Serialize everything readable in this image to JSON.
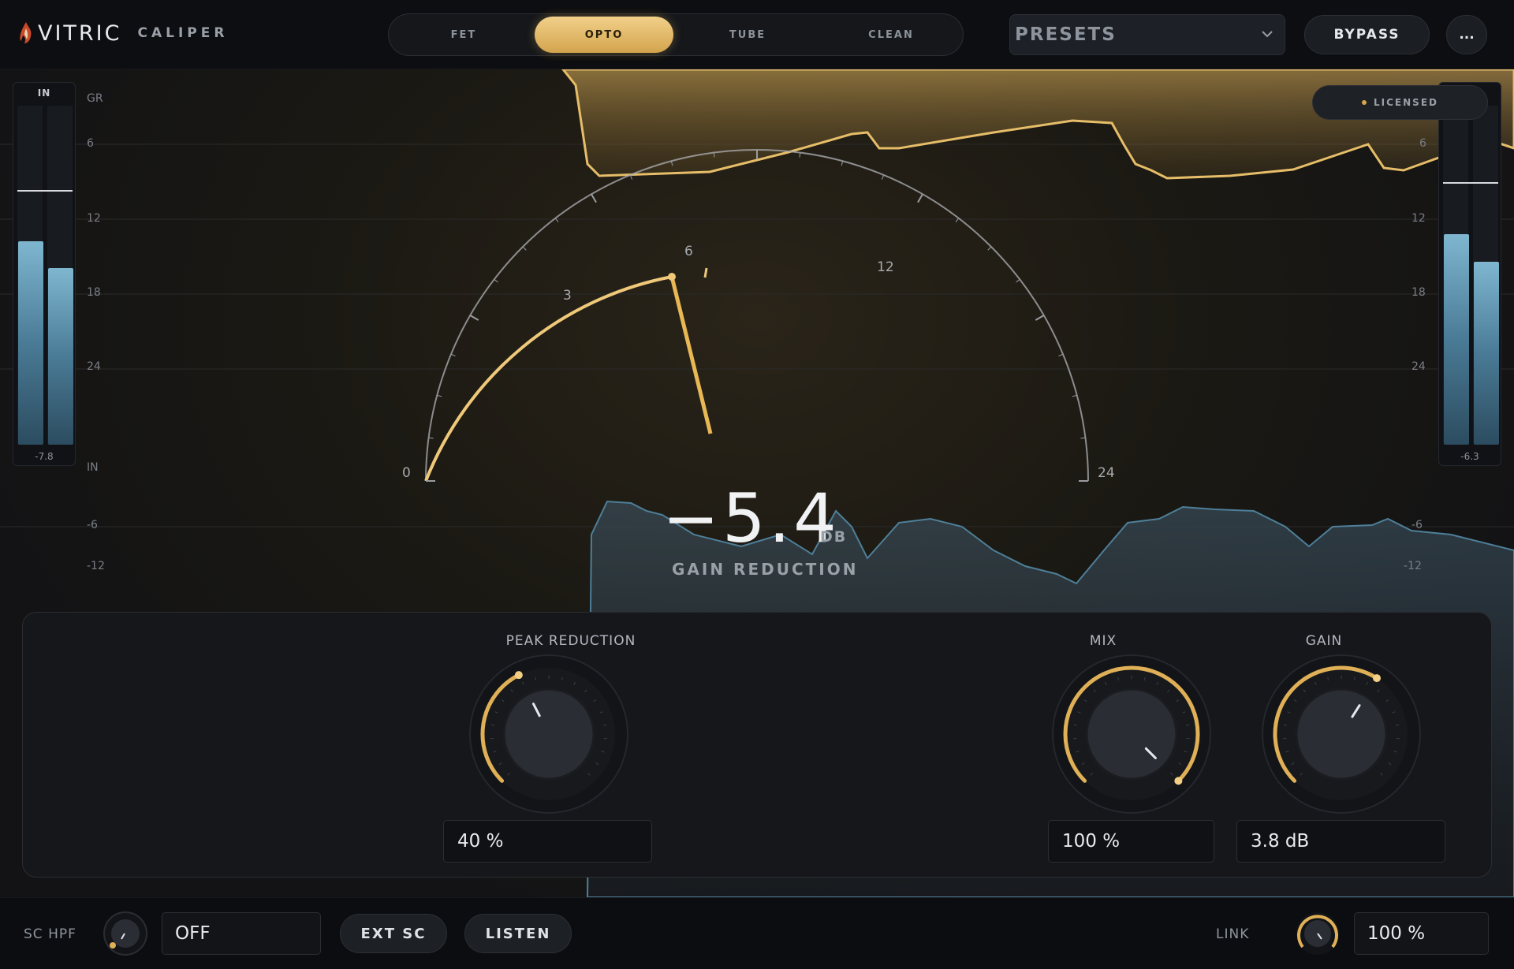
{
  "header": {
    "brand": "VITRIC",
    "product": "CALIPER",
    "logo_icon": "flame-logo-icon",
    "modes": [
      {
        "label": "FET",
        "active": false
      },
      {
        "label": "OPTO",
        "active": true
      },
      {
        "label": "TUBE",
        "active": false
      },
      {
        "label": "CLEAN",
        "active": false
      }
    ],
    "presets_label": "PRESETS",
    "bypass_label": "BYPASS",
    "more_label": "..."
  },
  "display": {
    "licensed_label": "LICENSED",
    "gr_scale_title": "GR",
    "in_scale_title": "IN",
    "gr_scale": [
      "6",
      "12",
      "18",
      "24"
    ],
    "in_scale": [
      "-6",
      "-12"
    ],
    "right_scale": [
      "6",
      "12",
      "18",
      "24",
      "-6",
      "-12"
    ],
    "meter_in": {
      "title": "IN",
      "reading": "-7.8",
      "levels": [
        0.6,
        0.52
      ]
    },
    "meter_out": {
      "reading": "-6.3",
      "levels": [
        0.62,
        0.54
      ]
    },
    "dial": {
      "tick_labels": [
        "0",
        "3",
        "6",
        "12",
        "24"
      ],
      "needle_value_db": 5.4,
      "peak_hold_db": 6.5
    },
    "gain_reduction_value": "−5.4",
    "gain_reduction_unit": "DB",
    "gain_reduction_label": "GAIN REDUCTION"
  },
  "controls": {
    "peak_reduction": {
      "title": "PEAK REDUCTION",
      "value": "40 %",
      "fraction": 0.4
    },
    "mix": {
      "title": "MIX",
      "value": "100 %",
      "fraction": 1.0
    },
    "gain": {
      "title": "GAIN",
      "value": "3.8 dB",
      "fraction": 0.62
    }
  },
  "bottom": {
    "sc_hpf_label": "SC HPF",
    "sc_hpf_value": "OFF",
    "ext_sc_label": "EXT SC",
    "listen_label": "LISTEN",
    "link_label": "LINK",
    "link_value": "100 %"
  },
  "colors": {
    "accent": "#e0b057",
    "meter_blue": "#6fa8c4",
    "background": "#0b0c0e"
  }
}
